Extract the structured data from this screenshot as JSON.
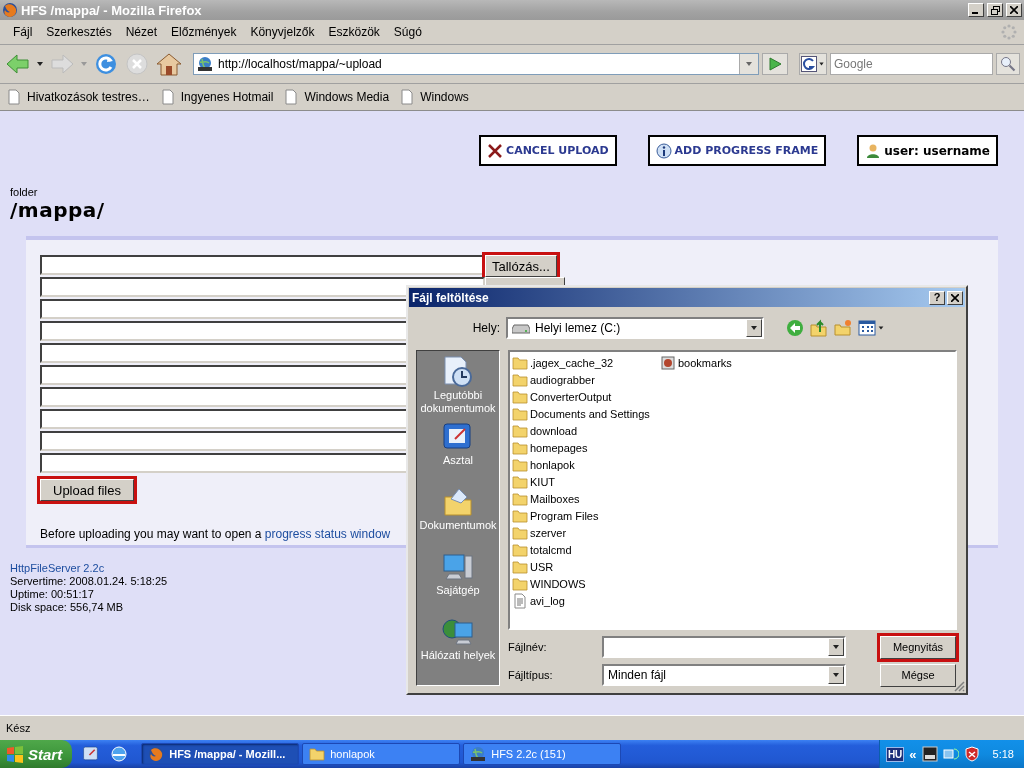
{
  "window": {
    "title": "HFS /mappa/ - Mozilla Firefox"
  },
  "menu": [
    "Fájl",
    "Szerkesztés",
    "Nézet",
    "Előzmények",
    "Könyvjelzők",
    "Eszközök",
    "Súgó"
  ],
  "address": {
    "url": "http://localhost/mappa/~upload"
  },
  "search": {
    "placeholder": "Google"
  },
  "bookmarks": [
    "Hivatkozások testres…",
    "Ingyenes Hotmail",
    "Windows Media",
    "Windows"
  ],
  "page": {
    "actions": [
      {
        "kind": "cancel",
        "label": "CANCEL UPLOAD"
      },
      {
        "kind": "progress",
        "label": "ADD PROGRESS FRAME"
      },
      {
        "kind": "user",
        "label": "user: username"
      }
    ],
    "folder_label": "folder",
    "folder_path": "/mappa/",
    "upload_rows": [
      {
        "kind": "with-button",
        "button": "Tallózás...",
        "highlighted": true
      },
      {
        "kind": "covered-button"
      },
      {
        "kind": "plain"
      },
      {
        "kind": "plain"
      },
      {
        "kind": "plain"
      },
      {
        "kind": "plain"
      },
      {
        "kind": "plain"
      },
      {
        "kind": "plain"
      },
      {
        "kind": "plain"
      },
      {
        "kind": "plain"
      }
    ],
    "upload_button": {
      "label": "Upload files",
      "highlighted": true
    },
    "hint": {
      "text": "Before uploading you may want to open a",
      "link": "progress status window"
    },
    "footer": {
      "server_link": "HttpFileServer 2.2c",
      "lines": [
        "Servertime: 2008.01.24. 5:18:25",
        "Uptime: 00:51:17",
        "Disk space: 556,74 MB"
      ]
    }
  },
  "dialog": {
    "title": "Fájl feltöltése",
    "help_button": "?",
    "location_label": "Hely:",
    "location": "Helyi lemez (C:)",
    "places": [
      {
        "kind": "recent",
        "label": "Legutóbbi dokumentumok"
      },
      {
        "kind": "desktop",
        "label": "Asztal"
      },
      {
        "kind": "documents",
        "label": "Dokumentumok"
      },
      {
        "kind": "computer",
        "label": "Sajátgép"
      },
      {
        "kind": "network",
        "label": "Hálózati helyek"
      }
    ],
    "files": [
      {
        "kind": "folder",
        "name": ".jagex_cache_32"
      },
      {
        "kind": "folder",
        "name": "audiograbber"
      },
      {
        "kind": "folder",
        "name": "ConverterOutput"
      },
      {
        "kind": "folder",
        "name": "Documents and Settings"
      },
      {
        "kind": "folder",
        "name": "download"
      },
      {
        "kind": "folder",
        "name": "homepages"
      },
      {
        "kind": "folder",
        "name": "honlapok"
      },
      {
        "kind": "folder",
        "name": "KIUT"
      },
      {
        "kind": "folder",
        "name": "Mailboxes"
      },
      {
        "kind": "folder",
        "name": "Program Files"
      },
      {
        "kind": "folder",
        "name": "szerver"
      },
      {
        "kind": "folder",
        "name": "totalcmd"
      },
      {
        "kind": "folder",
        "name": "USR"
      },
      {
        "kind": "folder",
        "name": "WINDOWS"
      },
      {
        "kind": "text-file",
        "name": "avi_log"
      },
      {
        "kind": "bookmark-file",
        "name": "bookmarks"
      }
    ],
    "filename_label": "Fájlnév:",
    "filetype_label": "Fájltípus:",
    "filetype": "Minden fájl",
    "buttons": [
      {
        "label": "Megnyitás",
        "highlighted": true
      },
      {
        "label": "Mégse",
        "highlighted": false
      }
    ]
  },
  "status_bar": "Kész",
  "taskbar": {
    "start": "Start",
    "tasks": [
      {
        "kind": "firefox",
        "label": "HFS /mappa/ - Mozill...",
        "selected": true
      },
      {
        "kind": "folder",
        "label": "honlapok",
        "selected": false
      },
      {
        "kind": "hfs",
        "label": "HFS 2.2c (151)",
        "selected": false
      }
    ],
    "tray": {
      "language": "HU",
      "expand": "«",
      "time": "5:18"
    }
  }
}
